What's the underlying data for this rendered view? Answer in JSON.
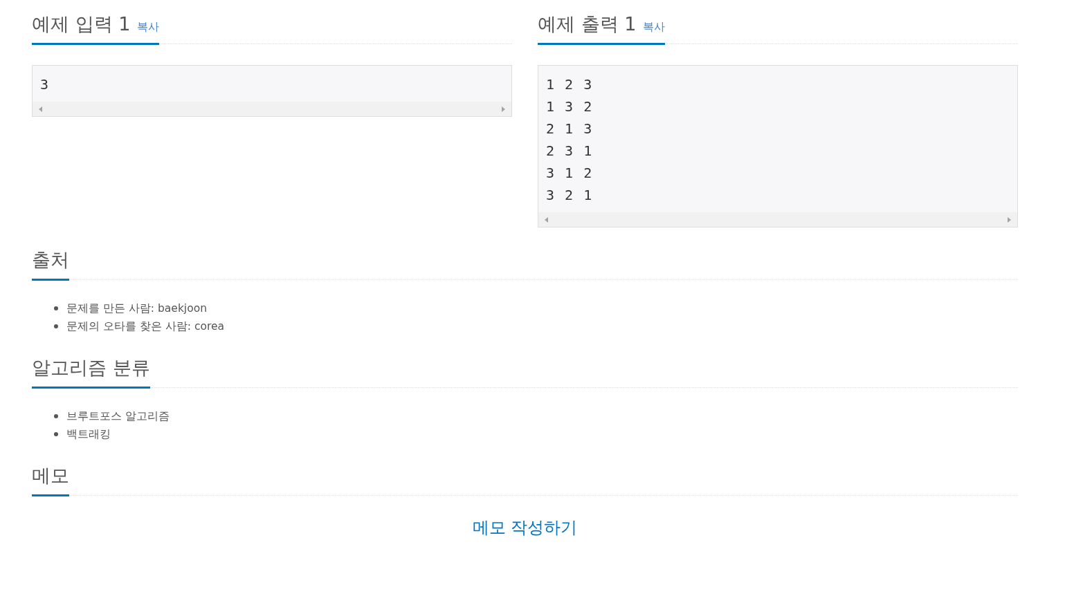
{
  "samples": [
    {
      "title": "예제 입력 1",
      "copy_link": "복사",
      "lines": [
        "3"
      ]
    },
    {
      "title": "예제 출력 1",
      "copy_link": "복사",
      "lines": [
        "1 2 3",
        "1 3 2",
        "2 1 3",
        "2 3 1",
        "3 1 2",
        "3 2 1"
      ]
    }
  ],
  "sections": [
    {
      "title": "출처",
      "items": [
        "문제를 만든 사람: baekjoon",
        "문제의 오타를 찾은 사람: corea"
      ]
    },
    {
      "title": "알고리즘 분류",
      "items": [
        "브루트포스 알고리즘",
        "백트래킹"
      ]
    },
    {
      "title": "메모",
      "link": "메모 작성하기"
    }
  ]
}
